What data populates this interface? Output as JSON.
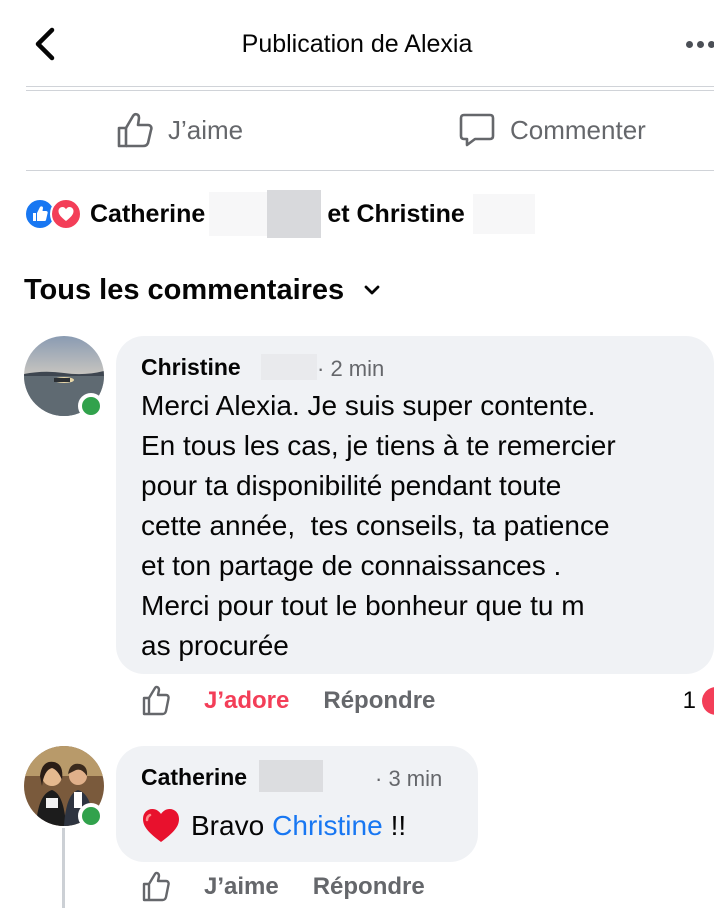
{
  "header": {
    "title": "Publication de Alexia",
    "back_icon": "chevron-left-icon",
    "more_icon": "more-dots-icon"
  },
  "action_bar": {
    "like_label": "J’aime",
    "comment_label": "Commenter"
  },
  "reactions": {
    "icons": [
      "like-icon",
      "love-icon"
    ],
    "name_first": "Catherine",
    "name_connector": "et Christine"
  },
  "comments_section": {
    "title": "Tous les commentaires"
  },
  "comments": [
    {
      "author": "Christine",
      "time": "· 2 min",
      "text": "Merci Alexia. Je suis super contente.\nEn tous les cas, je tiens à te remercier\npour ta disponibilité pendant toute\ncette année,  tes conseils, ta patience\net ton partage de connaissances .\nMerci pour tout le bonheur que tu m\nas procurée",
      "reaction_label": "J’adore",
      "reply_label": "Répondre",
      "reaction_count": "1"
    },
    {
      "author": "Catherine",
      "time": "· 3 min",
      "text_prefix": "Bravo",
      "mention": "Christine",
      "text_suffix": "!!",
      "reaction_label": "J’aime",
      "reply_label": "Répondre"
    }
  ],
  "colors": {
    "brand_blue": "#1877f2",
    "love_red": "#f33e58",
    "online_green": "#31a24c",
    "bubble_bg": "#f0f2f5",
    "secondary_text": "#65676b"
  }
}
